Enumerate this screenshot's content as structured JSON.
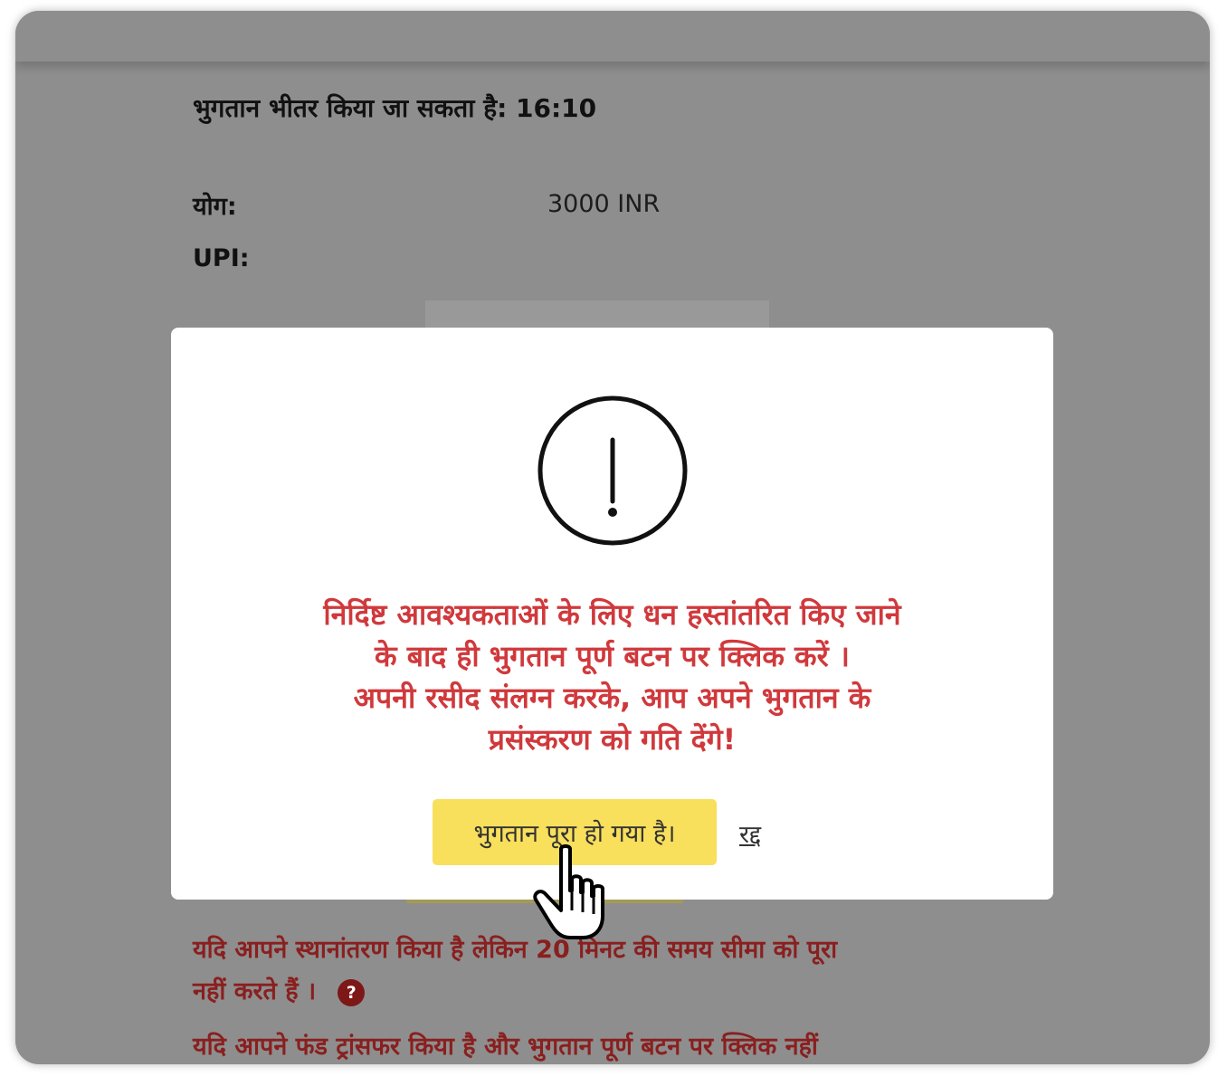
{
  "payment": {
    "timer_text": "भुगतान भीतर किया जा सकता है: 16:10",
    "amount_label": "योग:",
    "amount_value": "3000 INR",
    "upi_label": "UPI:"
  },
  "notes": {
    "line1": "यदि आपने स्थानांतरण किया है लेकिन 20 मिनट की समय सीमा को पूरा",
    "line2": "नहीं करते हैं ।",
    "help_icon_glyph": "?",
    "line3": "यदि आपने फंड ट्रांसफर किया है और भुगतान पूर्ण बटन पर क्लिक नहीं"
  },
  "modal": {
    "icon": "exclamation-circle-icon",
    "message_lines": [
      "निर्दिष्ट आवश्यकताओं के लिए धन हस्तांतरित किए जाने",
      "के बाद ही भुगतान पूर्ण बटन पर क्लिक करें ।",
      "अपनी रसीद संलग्न करके, आप अपने भुगतान के",
      "प्रसंस्करण को गति देंगे!"
    ],
    "confirm_label": "भुगतान पूरा हो गया है।",
    "cancel_label": "रद्द"
  },
  "colors": {
    "overlay_bg": "#8e8e8e",
    "modal_message": "#d0393c",
    "note_text": "#8a1f1f",
    "confirm_button": "#f8df5c"
  },
  "cursor": "hand-pointer-icon"
}
